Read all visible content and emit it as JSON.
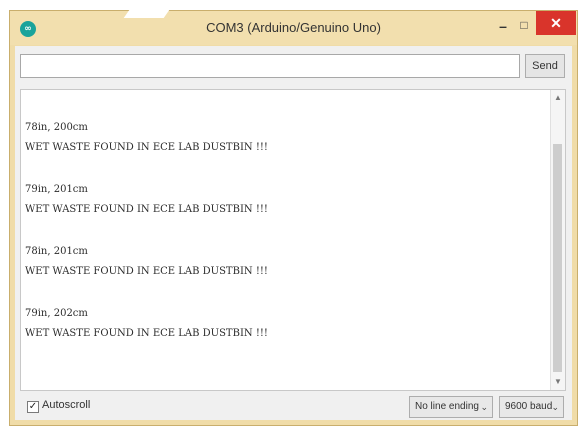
{
  "window": {
    "title": "COM3 (Arduino/Genuino Uno)",
    "app_icon_glyph": "∞",
    "minimize_glyph": "–",
    "maximize_glyph": "□",
    "close_glyph": "✕"
  },
  "send_bar": {
    "input_value": "",
    "send_label": "Send"
  },
  "serial_output": {
    "lines": [
      "78in, 200cm",
      "WET WASTE FOUND IN ECE LAB DUSTBIN !!!",
      "79in, 201cm",
      "WET WASTE FOUND IN ECE LAB DUSTBIN !!!",
      "78in, 201cm",
      "WET WASTE FOUND IN ECE LAB DUSTBIN !!!",
      "79in, 202cm",
      "WET WASTE FOUND IN ECE LAB DUSTBIN !!!"
    ]
  },
  "scrollbar": {
    "up_glyph": "▲",
    "down_glyph": "▼"
  },
  "footer": {
    "autoscroll_checked": true,
    "autoscroll_check_glyph": "✓",
    "autoscroll_label": "Autoscroll",
    "line_ending_value": "No line ending",
    "baud_value": "9600 baud",
    "dropdown_glyph": "⌄"
  },
  "colors": {
    "title_bar": "#f2dfae",
    "close_button": "#d9342b",
    "app_icon": "#1aa39b"
  }
}
